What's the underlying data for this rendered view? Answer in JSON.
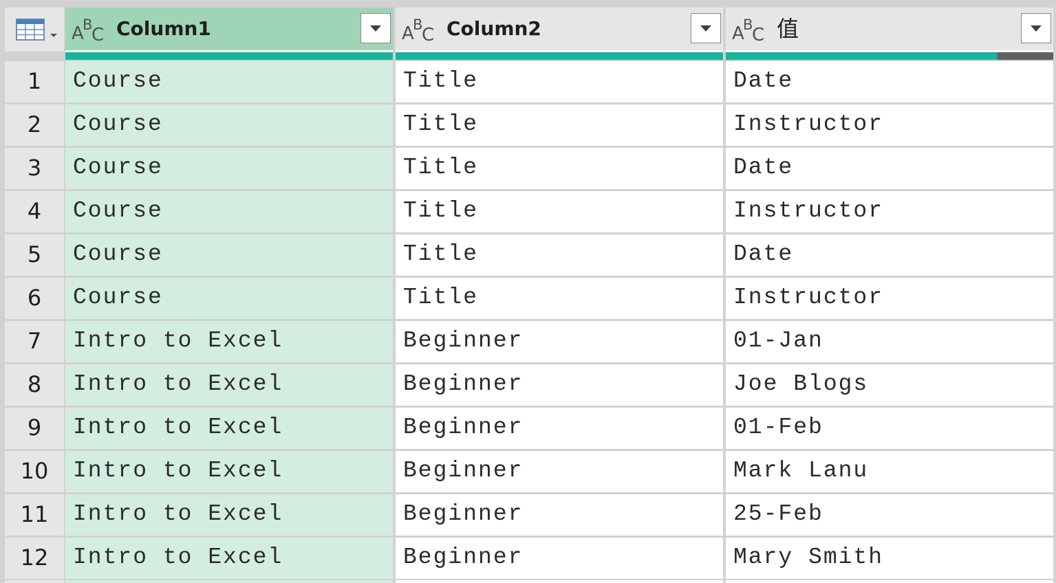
{
  "columns": [
    {
      "name": "Column1",
      "type_icon": "text-type-icon",
      "valid_fraction": 1.0
    },
    {
      "name": "Column2",
      "type_icon": "text-type-icon",
      "valid_fraction": 1.0
    },
    {
      "name": "值",
      "type_icon": "text-type-icon",
      "valid_fraction": 0.83
    }
  ],
  "rows": [
    {
      "n": "1",
      "c1": "Course",
      "c2": "Title",
      "c3": "Date"
    },
    {
      "n": "2",
      "c1": "Course",
      "c2": "Title",
      "c3": "Instructor"
    },
    {
      "n": "3",
      "c1": "Course",
      "c2": "Title",
      "c3": "Date"
    },
    {
      "n": "4",
      "c1": "Course",
      "c2": "Title",
      "c3": "Instructor"
    },
    {
      "n": "5",
      "c1": "Course",
      "c2": "Title",
      "c3": "Date"
    },
    {
      "n": "6",
      "c1": "Course",
      "c2": "Title",
      "c3": "Instructor"
    },
    {
      "n": "7",
      "c1": "Intro to Excel",
      "c2": "Beginner",
      "c3": "01-Jan"
    },
    {
      "n": "8",
      "c1": "Intro to Excel",
      "c2": "Beginner",
      "c3": "Joe Blogs"
    },
    {
      "n": "9",
      "c1": "Intro to Excel",
      "c2": "Beginner",
      "c3": "01-Feb"
    },
    {
      "n": "10",
      "c1": "Intro to Excel",
      "c2": "Beginner",
      "c3": "Mark Lanu"
    },
    {
      "n": "11",
      "c1": "Intro to Excel",
      "c2": "Beginner",
      "c3": "25-Feb"
    },
    {
      "n": "12",
      "c1": "Intro to Excel",
      "c2": "Beginner",
      "c3": "Mary Smith"
    }
  ],
  "colors": {
    "selected_header": "#9fd5b6",
    "selected_cell": "#d3eee0",
    "quality_valid": "#1ab49a",
    "quality_empty": "#606060"
  }
}
